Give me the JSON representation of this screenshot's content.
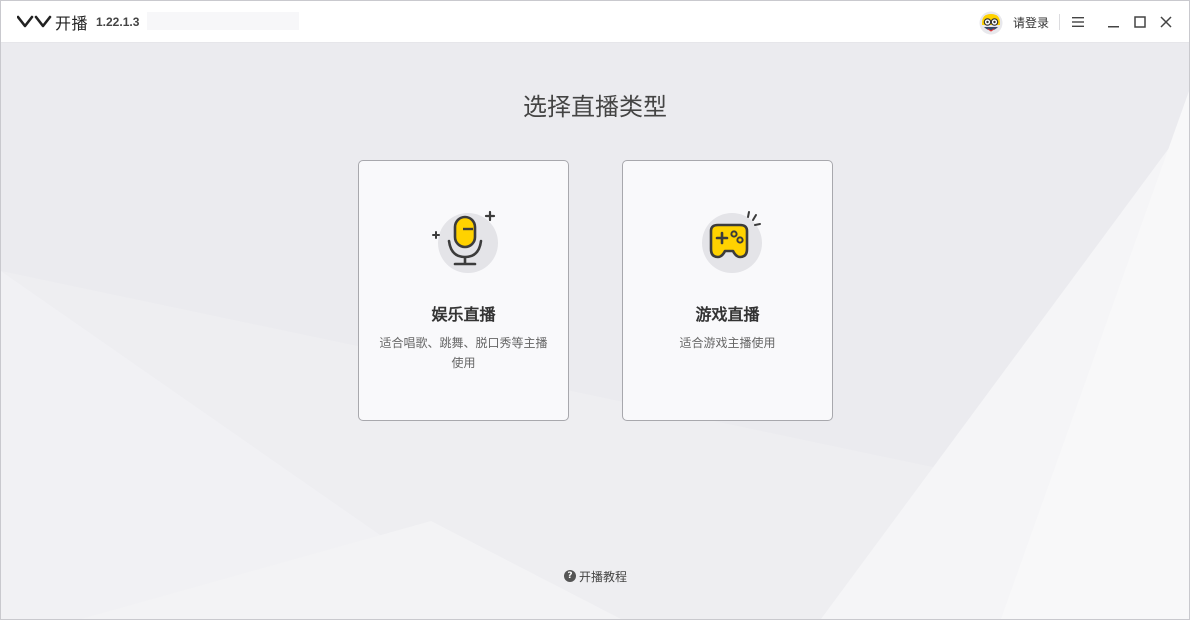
{
  "app": {
    "name": "开播",
    "version": "1.22.1.3"
  },
  "titlebar": {
    "login_label": "请登录",
    "menu_icon": "hamburger-icon",
    "minimize_icon": "minimize-icon",
    "maximize_icon": "maximize-icon",
    "close_icon": "close-icon"
  },
  "main": {
    "title": "选择直播类型",
    "cards": [
      {
        "title": "娱乐直播",
        "description": "适合唱歌、跳舞、脱口秀等主播使用",
        "icon": "microphone-icon"
      },
      {
        "title": "游戏直播",
        "description": "适合游戏主播使用",
        "icon": "gamepad-icon"
      }
    ]
  },
  "footer": {
    "tutorial_label": "开播教程",
    "help_icon": "help-icon"
  },
  "colors": {
    "accent_yellow": "#FFD200",
    "icon_dark": "#3c3c3c",
    "icon_circle": "#e4e4e8",
    "card_border": "#a8a8ad"
  }
}
